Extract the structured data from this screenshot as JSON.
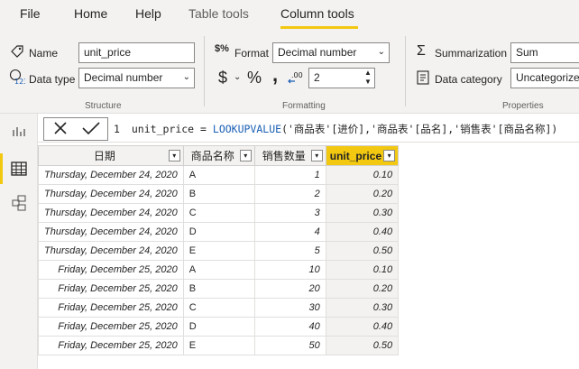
{
  "menu": {
    "file": "File",
    "home": "Home",
    "help": "Help",
    "table_tools": "Table tools",
    "column_tools": "Column tools"
  },
  "ribbon": {
    "structure": {
      "label": "Structure",
      "name_label": "Name",
      "name_value": "unit_price",
      "datatype_label": "Data type",
      "datatype_value": "Decimal number"
    },
    "formatting": {
      "label": "Formatting",
      "format_label": "Format",
      "format_value": "Decimal number",
      "currency_symbol": "$",
      "percent_symbol": "%",
      "comma_symbol": ",",
      "decimals_value": "2"
    },
    "properties": {
      "label": "Properties",
      "summarization_label": "Summarization",
      "summarization_value": "Sum",
      "category_label": "Data category",
      "category_value": "Uncategorized"
    }
  },
  "formula": {
    "line_no": "1",
    "lhs": "unit_price = ",
    "func": "LOOKUPVALUE",
    "args": "('商品表'[进价],'商品表'[品名],'销售表'[商品名称])"
  },
  "table": {
    "columns": [
      "日期",
      "商品名称",
      "销售数量",
      "unit_price"
    ],
    "rows": [
      [
        "Thursday, December 24, 2020",
        "A",
        "1",
        "0.10"
      ],
      [
        "Thursday, December 24, 2020",
        "B",
        "2",
        "0.20"
      ],
      [
        "Thursday, December 24, 2020",
        "C",
        "3",
        "0.30"
      ],
      [
        "Thursday, December 24, 2020",
        "D",
        "4",
        "0.40"
      ],
      [
        "Thursday, December 24, 2020",
        "E",
        "5",
        "0.50"
      ],
      [
        "Friday, December 25, 2020",
        "A",
        "10",
        "0.10"
      ],
      [
        "Friday, December 25, 2020",
        "B",
        "20",
        "0.20"
      ],
      [
        "Friday, December 25, 2020",
        "C",
        "30",
        "0.30"
      ],
      [
        "Friday, December 25, 2020",
        "D",
        "40",
        "0.40"
      ],
      [
        "Friday, December 25, 2020",
        "E",
        "50",
        "0.50"
      ]
    ]
  },
  "colors": {
    "accent": "#f2c811",
    "ribbon_bg": "#f3f2f1",
    "dax_function": "#1a5fb4"
  }
}
